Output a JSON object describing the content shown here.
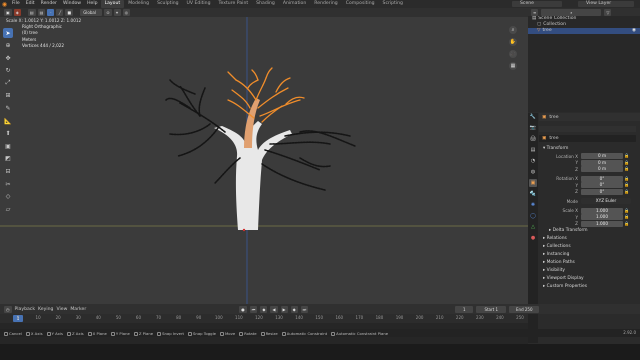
{
  "top_menu": [
    "File",
    "Edit",
    "Render",
    "Window",
    "Help"
  ],
  "workspaces": [
    {
      "label": "Layout",
      "active": true
    },
    {
      "label": "Modeling",
      "active": false
    },
    {
      "label": "Sculpting",
      "active": false
    },
    {
      "label": "UV Editing",
      "active": false
    },
    {
      "label": "Texture Paint",
      "active": false
    },
    {
      "label": "Shading",
      "active": false
    },
    {
      "label": "Animation",
      "active": false
    },
    {
      "label": "Rendering",
      "active": false
    },
    {
      "label": "Compositing",
      "active": false
    },
    {
      "label": "Scripting",
      "active": false
    }
  ],
  "scene": "Scene",
  "view_layer": "View Layer",
  "viewport": {
    "transform_orientation": "Global",
    "overlay_lines": [
      "Right Orthographic",
      "(0) tree",
      "Meters",
      "",
      "Vertices   444 / 2,022"
    ],
    "version_hint": "Scale X: 1.0012   Y: 1.0012   Z: 1.0012"
  },
  "tools": [
    "cursor-select",
    "cursor",
    "move",
    "rotate",
    "scale",
    "transform",
    "annotate",
    "measure",
    "add-cube",
    "extrude",
    "inset",
    "bevel",
    "loop-cut",
    "knife",
    "poly-build",
    "spin",
    "smooth",
    "shrink",
    "shear"
  ],
  "outliner": {
    "rows": [
      {
        "label": "Scene Collection",
        "indent": 0,
        "selected": false
      },
      {
        "label": "Collection",
        "indent": 1,
        "selected": false
      },
      {
        "label": "tree",
        "indent": 1,
        "selected": true
      }
    ]
  },
  "properties": {
    "object_name": "tree",
    "header_name": "tree",
    "transform_label": "Transform",
    "location": {
      "label": "Location X",
      "rows": [
        [
          "Location X",
          "0 m"
        ],
        [
          "Y",
          "0 m"
        ],
        [
          "Z",
          "0 m"
        ]
      ]
    },
    "rotation": {
      "rows": [
        [
          "Rotation X",
          "0°"
        ],
        [
          "Y",
          "0°"
        ],
        [
          "Z",
          "0°"
        ]
      ]
    },
    "mode": [
      "Mode",
      "XYZ Euler"
    ],
    "scale": {
      "rows": [
        [
          "Scale X",
          "1.000"
        ],
        [
          "Y",
          "1.000"
        ],
        [
          "Z",
          "1.000"
        ]
      ]
    },
    "sections": [
      "Delta Transform",
      "Relations",
      "Collections",
      "Instancing",
      "Motion Paths",
      "Visibility",
      "Viewport Display",
      "Custom Properties"
    ]
  },
  "timeline": {
    "menus": [
      "Playback",
      "Keying",
      "View",
      "Marker"
    ],
    "current_frame": "1",
    "start_label": "Start",
    "start": "1",
    "end_label": "End",
    "end": "250",
    "ticks": [
      "0",
      "10",
      "20",
      "30",
      "40",
      "50",
      "60",
      "70",
      "80",
      "90",
      "100",
      "110",
      "120",
      "130",
      "140",
      "150",
      "160",
      "170",
      "180",
      "190",
      "200",
      "210",
      "220",
      "230",
      "240",
      "250"
    ]
  },
  "status_bar": [
    "Cancel",
    "X Axis",
    "Y Axis",
    "Z Axis",
    "X Plane",
    "Y Plane",
    "Z Plane",
    "Snap Invert",
    "Snap Toggle",
    "Move",
    "Rotate",
    "Resize",
    "Automatic Constraint",
    "Automatic Constraint Plane"
  ],
  "version": "2.92.0",
  "colors": {
    "accent": "#4772b3",
    "selected_orange": "#f08d2b",
    "grid_x": "#7a3a3a",
    "grid_y": "#5a7a2a"
  }
}
